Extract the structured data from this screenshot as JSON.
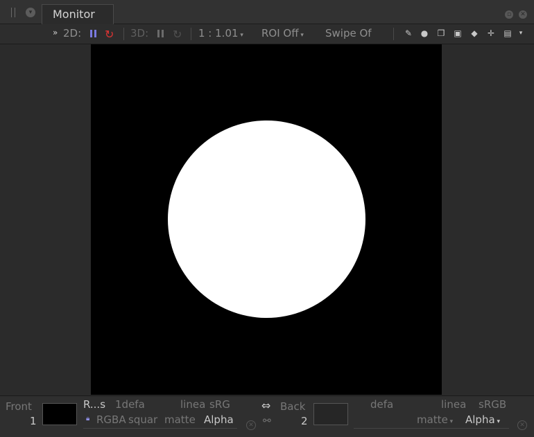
{
  "panel": {
    "tab_title": "Monitor"
  },
  "toolbar": {
    "label_2d": "2D:",
    "label_3d": "3D:",
    "zoom": "1 : 1.01",
    "roi": "ROI Off",
    "swipe": "Swipe Of"
  },
  "front": {
    "label": "Front",
    "number": "1",
    "layer": "R...s",
    "colorspace_in": "1defa",
    "colorspace_view": "linea",
    "colorspace_out": "sRG",
    "channels": "RGBA",
    "aspect": "squar",
    "matte": "matte",
    "alpha": "Alpha"
  },
  "back": {
    "label": "Back",
    "number": "2",
    "colorspace_in": "defa",
    "colorspace_view": "linea",
    "colorspace_out": "sRGB",
    "matte": "matte",
    "alpha": "Alpha"
  },
  "colors": {
    "background": "#2b2b2b",
    "canvas": "#000000",
    "shape": "#ffffff",
    "sync_active": "#dd3333",
    "pause_active": "#7a7ae0"
  }
}
